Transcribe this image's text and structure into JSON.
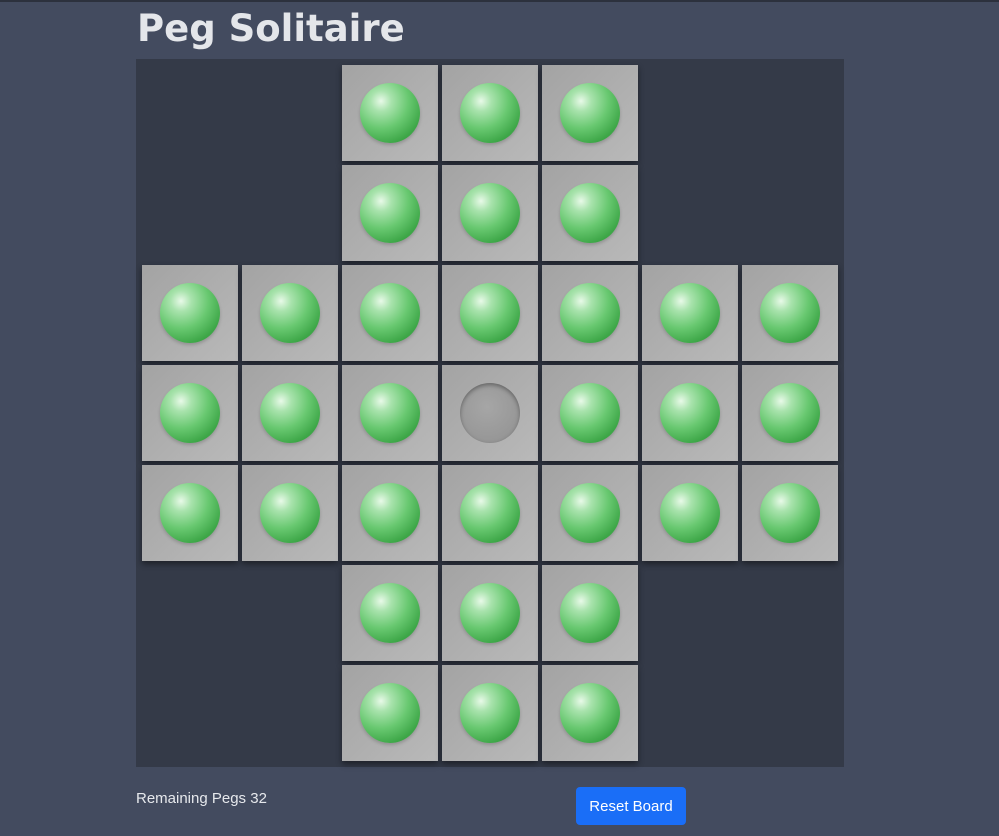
{
  "title": "Peg Solitaire",
  "board": {
    "layout": [
      "..OOO..",
      "..OOO..",
      "OOOOOOO",
      "OOO.OOO",
      "OOOOOOO",
      "..OOO..",
      "..OOO.."
    ]
  },
  "status": {
    "remaining_label": "Remaining Pegs",
    "remaining_count": "32"
  },
  "controls": {
    "reset_label": "Reset Board"
  },
  "colors": {
    "background": "#434b5f",
    "board": "#343a48",
    "peg": "#4fb858",
    "button": "#1a6ef7"
  }
}
